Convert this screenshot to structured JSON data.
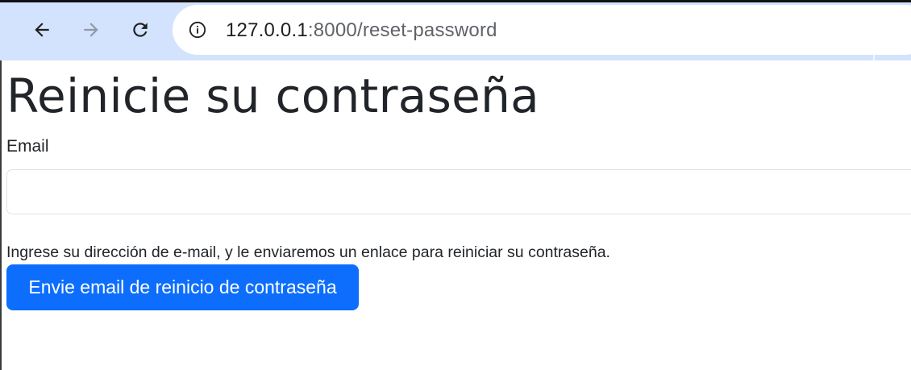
{
  "browser": {
    "url_host": "127.0.0.1",
    "url_rest": ":8000/reset-password",
    "icons": [
      "back-arrow-icon",
      "forward-arrow-icon",
      "reload-icon",
      "info-icon"
    ]
  },
  "page": {
    "title": "Reinicie su contraseña",
    "email_label": "Email",
    "email_value": "",
    "help_text": "Ingrese su dirección de e-mail, y le enviaremos un enlace para reiniciar su contraseña.",
    "submit_label": "Envie email de reinicio de contraseña"
  },
  "colors": {
    "toolbar": "#d3e3fd",
    "primary_button": "#0d6efd",
    "text": "#212529"
  }
}
